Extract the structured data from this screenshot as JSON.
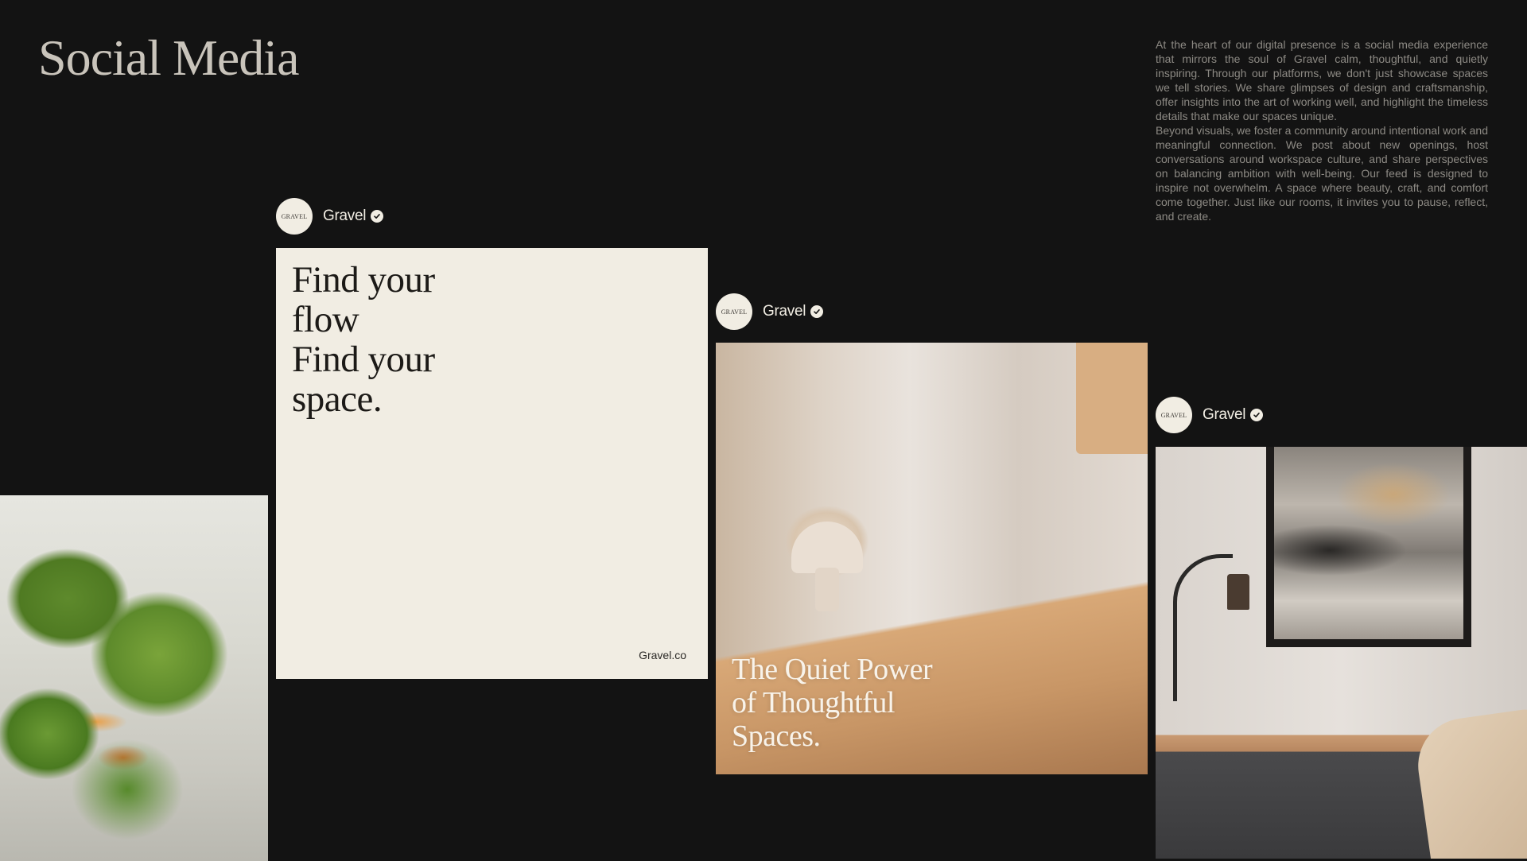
{
  "page": {
    "title": "Social Media",
    "intro_paragraphs": [
      "At the heart of our digital presence is a social media experience that mirrors the soul of Gravel calm, thoughtful, and quietly inspiring. Through our platforms, we don't just showcase spaces we tell stories. We share glimpses of design and craftsmanship, offer insights into the art of working well, and highlight the timeless details that make our spaces unique.",
      "Beyond visuals, we foster a community around intentional work and meaningful connection. We post about new openings, host conversations around workspace culture, and share perspectives on balancing ambition with well-being. Our feed is designed to inspire not overwhelm. A space where beauty, craft, and comfort come together. Just like our rooms, it invites you to pause, reflect, and create."
    ]
  },
  "brand": {
    "avatar_text": "GRAVEL",
    "handle": "Gravel"
  },
  "posts": [
    {
      "headline_lines": [
        "Find your",
        "flow",
        "Find your",
        "space."
      ],
      "footer": "Gravel.co"
    },
    {
      "headline_lines": [
        "The Quiet Power",
        "of Thoughtful",
        "Spaces."
      ]
    },
    {}
  ],
  "colors": {
    "background": "#131313",
    "cream": "#f1ede3",
    "title_text": "#c9c4bb",
    "body_text": "#8d8a84"
  },
  "icons": {
    "verified": "verified-badge-icon"
  }
}
